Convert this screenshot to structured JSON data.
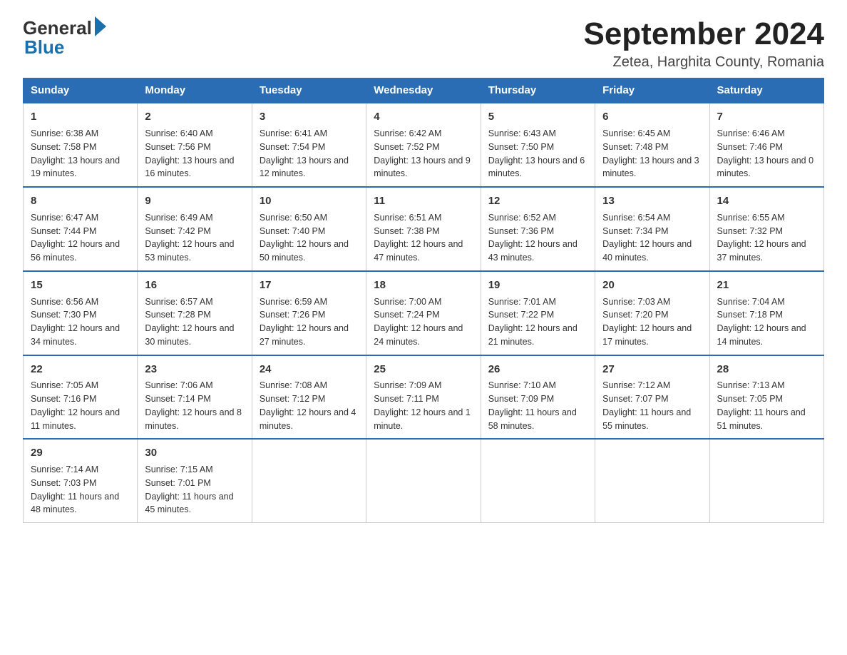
{
  "header": {
    "logo_general": "General",
    "logo_blue": "Blue",
    "month_year": "September 2024",
    "location": "Zetea, Harghita County, Romania"
  },
  "days_of_week": [
    "Sunday",
    "Monday",
    "Tuesday",
    "Wednesday",
    "Thursday",
    "Friday",
    "Saturday"
  ],
  "weeks": [
    [
      {
        "day": "1",
        "sunrise": "6:38 AM",
        "sunset": "7:58 PM",
        "daylight": "13 hours and 19 minutes."
      },
      {
        "day": "2",
        "sunrise": "6:40 AM",
        "sunset": "7:56 PM",
        "daylight": "13 hours and 16 minutes."
      },
      {
        "day": "3",
        "sunrise": "6:41 AM",
        "sunset": "7:54 PM",
        "daylight": "13 hours and 12 minutes."
      },
      {
        "day": "4",
        "sunrise": "6:42 AM",
        "sunset": "7:52 PM",
        "daylight": "13 hours and 9 minutes."
      },
      {
        "day": "5",
        "sunrise": "6:43 AM",
        "sunset": "7:50 PM",
        "daylight": "13 hours and 6 minutes."
      },
      {
        "day": "6",
        "sunrise": "6:45 AM",
        "sunset": "7:48 PM",
        "daylight": "13 hours and 3 minutes."
      },
      {
        "day": "7",
        "sunrise": "6:46 AM",
        "sunset": "7:46 PM",
        "daylight": "13 hours and 0 minutes."
      }
    ],
    [
      {
        "day": "8",
        "sunrise": "6:47 AM",
        "sunset": "7:44 PM",
        "daylight": "12 hours and 56 minutes."
      },
      {
        "day": "9",
        "sunrise": "6:49 AM",
        "sunset": "7:42 PM",
        "daylight": "12 hours and 53 minutes."
      },
      {
        "day": "10",
        "sunrise": "6:50 AM",
        "sunset": "7:40 PM",
        "daylight": "12 hours and 50 minutes."
      },
      {
        "day": "11",
        "sunrise": "6:51 AM",
        "sunset": "7:38 PM",
        "daylight": "12 hours and 47 minutes."
      },
      {
        "day": "12",
        "sunrise": "6:52 AM",
        "sunset": "7:36 PM",
        "daylight": "12 hours and 43 minutes."
      },
      {
        "day": "13",
        "sunrise": "6:54 AM",
        "sunset": "7:34 PM",
        "daylight": "12 hours and 40 minutes."
      },
      {
        "day": "14",
        "sunrise": "6:55 AM",
        "sunset": "7:32 PM",
        "daylight": "12 hours and 37 minutes."
      }
    ],
    [
      {
        "day": "15",
        "sunrise": "6:56 AM",
        "sunset": "7:30 PM",
        "daylight": "12 hours and 34 minutes."
      },
      {
        "day": "16",
        "sunrise": "6:57 AM",
        "sunset": "7:28 PM",
        "daylight": "12 hours and 30 minutes."
      },
      {
        "day": "17",
        "sunrise": "6:59 AM",
        "sunset": "7:26 PM",
        "daylight": "12 hours and 27 minutes."
      },
      {
        "day": "18",
        "sunrise": "7:00 AM",
        "sunset": "7:24 PM",
        "daylight": "12 hours and 24 minutes."
      },
      {
        "day": "19",
        "sunrise": "7:01 AM",
        "sunset": "7:22 PM",
        "daylight": "12 hours and 21 minutes."
      },
      {
        "day": "20",
        "sunrise": "7:03 AM",
        "sunset": "7:20 PM",
        "daylight": "12 hours and 17 minutes."
      },
      {
        "day": "21",
        "sunrise": "7:04 AM",
        "sunset": "7:18 PM",
        "daylight": "12 hours and 14 minutes."
      }
    ],
    [
      {
        "day": "22",
        "sunrise": "7:05 AM",
        "sunset": "7:16 PM",
        "daylight": "12 hours and 11 minutes."
      },
      {
        "day": "23",
        "sunrise": "7:06 AM",
        "sunset": "7:14 PM",
        "daylight": "12 hours and 8 minutes."
      },
      {
        "day": "24",
        "sunrise": "7:08 AM",
        "sunset": "7:12 PM",
        "daylight": "12 hours and 4 minutes."
      },
      {
        "day": "25",
        "sunrise": "7:09 AM",
        "sunset": "7:11 PM",
        "daylight": "12 hours and 1 minute."
      },
      {
        "day": "26",
        "sunrise": "7:10 AM",
        "sunset": "7:09 PM",
        "daylight": "11 hours and 58 minutes."
      },
      {
        "day": "27",
        "sunrise": "7:12 AM",
        "sunset": "7:07 PM",
        "daylight": "11 hours and 55 minutes."
      },
      {
        "day": "28",
        "sunrise": "7:13 AM",
        "sunset": "7:05 PM",
        "daylight": "11 hours and 51 minutes."
      }
    ],
    [
      {
        "day": "29",
        "sunrise": "7:14 AM",
        "sunset": "7:03 PM",
        "daylight": "11 hours and 48 minutes."
      },
      {
        "day": "30",
        "sunrise": "7:15 AM",
        "sunset": "7:01 PM",
        "daylight": "11 hours and 45 minutes."
      },
      null,
      null,
      null,
      null,
      null
    ]
  ],
  "labels": {
    "sunrise": "Sunrise:",
    "sunset": "Sunset:",
    "daylight": "Daylight:"
  }
}
